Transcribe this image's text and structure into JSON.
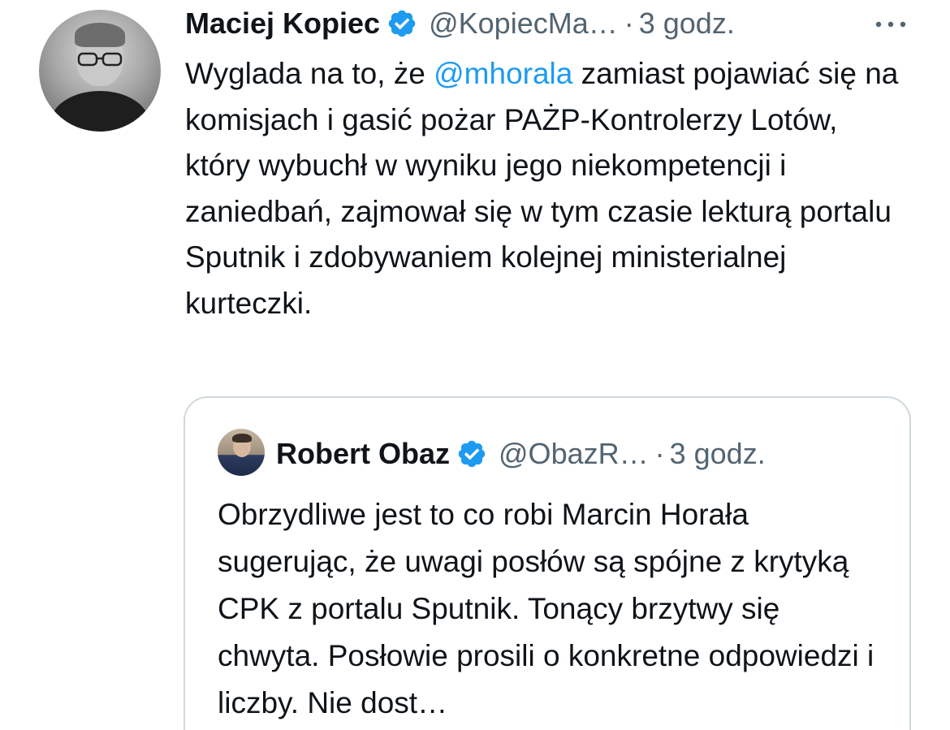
{
  "tweet": {
    "author_name": "Maciej Kopiec",
    "handle": "@KopiecMa…",
    "separator": "·",
    "time": "3 godz.",
    "text_before_mention": "Wyglada na to, że ",
    "mention": "@mhorala",
    "text_after_mention": " zamiast pojawiać się na komisjach i gasić pożar PAŻP-Kontrolerzy Lotów, który wybuchł w wyniku jego niekompetencji i zaniedbań, zajmował się w tym czasie lekturą portalu Sputnik i zdobywaniem kolejnej ministerialnej kurteczki.",
    "verified_icon": "verified-badge-icon",
    "more_icon": "more-options-icon"
  },
  "quoted_tweet": {
    "author_name": "Robert Obaz",
    "handle": "@ObazR…",
    "separator": "·",
    "time": "3 godz.",
    "text": "Obrzydliwe jest to co robi Marcin Horała sugerując, że uwagi posłów są spójne z krytyką CPK z portalu Sputnik. Tonący brzytwy się chwyta. Posłowie prosili o konkretne odpowiedzi i liczby. Nie dost…",
    "verified_icon": "verified-badge-icon"
  },
  "colors": {
    "text": "#0f1419",
    "secondary": "#536471",
    "link": "#1d9bf0",
    "border": "#cfd9de",
    "verified": "#1d9bf0"
  }
}
